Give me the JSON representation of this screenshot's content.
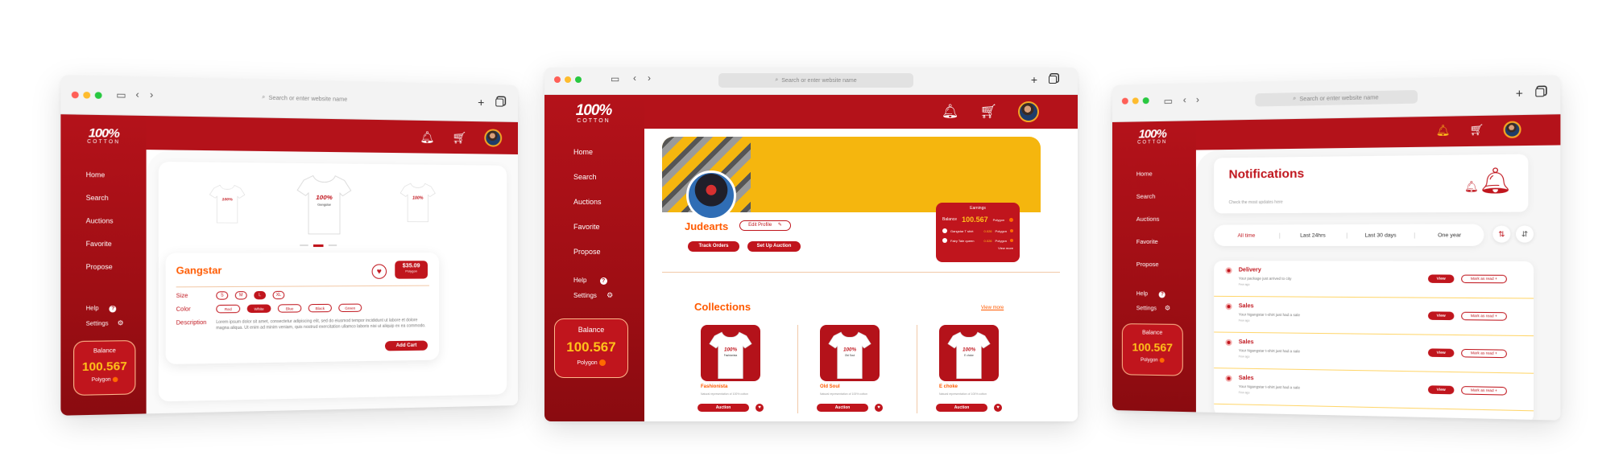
{
  "colors": {
    "brand_red": "#b4121a",
    "accent_orange": "#ff5a00",
    "accent_yellow": "#ffc21a"
  },
  "common": {
    "search_placeholder": "Search or enter website name",
    "logo_big": "100%",
    "logo_small": "COTTON",
    "menu": [
      "Home",
      "Search",
      "Auctions",
      "Favorite",
      "Propose"
    ],
    "help": "Help",
    "help_icon": "?",
    "settings": "Settings",
    "balance_label": "Balance",
    "balance_amount": "100.567",
    "currency": "Polygon",
    "icons": [
      "bell-icon",
      "cart-icon",
      "avatar"
    ]
  },
  "product": {
    "name": "Gangstar",
    "price": "$35.09",
    "price_currency": "Polygon",
    "size_label": "Size",
    "sizes": [
      "S",
      "M",
      "L",
      "XL"
    ],
    "size_selected": "L",
    "color_label": "Color",
    "colors": [
      "Red",
      "White",
      "Blue",
      "Black",
      "Green"
    ],
    "color_selected": "White",
    "description_label": "Description",
    "description": "Lorem ipsum dolor sit amet, consectetur adipiscing elit, sed do eiusmod tempor incididunt ut labore et dolore magna aliqua. Ut enim ad minim veniam, quis nostrud exercitation ullamco laboris nisi ut aliquip ex ea commodo.",
    "add_cart": "Add Cart",
    "tee_print": "Gangstar"
  },
  "profile": {
    "username": "Judearts",
    "edit_profile": "Edit Profile",
    "track_orders": "Track Orders",
    "set_up_auction": "Set Up Auction",
    "earnings": {
      "title": "Earnings",
      "balance_label": "Balance",
      "balance_value": "100.567",
      "currency": "Polygon",
      "items": [
        {
          "name": "Gangstar T shirt",
          "amount": "0.026",
          "currency": "Polygon"
        },
        {
          "name": "Fairy Tale queen",
          "amount": "0.026",
          "currency": "Polygon"
        }
      ],
      "view_more": "View more"
    },
    "collections_title": "Collections",
    "collections_view_more": "View more",
    "collections": [
      {
        "name": "Fashionista",
        "print": "Fashionista",
        "desc": "Natural representation of 100% cotton",
        "action": "Auction"
      },
      {
        "name": "Old Soul",
        "print": "Old Soul",
        "desc": "Natural representation of 100% cotton",
        "action": "Auction"
      },
      {
        "name": "E choke",
        "print": "E choke",
        "desc": "Natural representation of 100% cotton",
        "action": "Auction"
      }
    ]
  },
  "notifications": {
    "title": "Notifications",
    "subtitle": "Check the most updates here",
    "filters": [
      "All time",
      "Last 24hrs",
      "Last 30 days",
      "One year"
    ],
    "filter_selected": "All time",
    "items": [
      {
        "title": "Delivery",
        "text": "Your package just arrived to city",
        "meta": "Few ago",
        "view": "View",
        "mark": "Mark as read"
      },
      {
        "title": "Sales",
        "text": "Your Ngangstar t-shirt just had a sale",
        "meta": "Few ago",
        "view": "View",
        "mark": "Mark as read"
      },
      {
        "title": "Sales",
        "text": "Your Ngangstar t-shirt just had a sale",
        "meta": "Few ago",
        "view": "View",
        "mark": "Mark as read"
      },
      {
        "title": "Sales",
        "text": "Your Ngangstar t-shirt just had a sale",
        "meta": "Few ago",
        "view": "View",
        "mark": "Mark as read"
      }
    ]
  }
}
